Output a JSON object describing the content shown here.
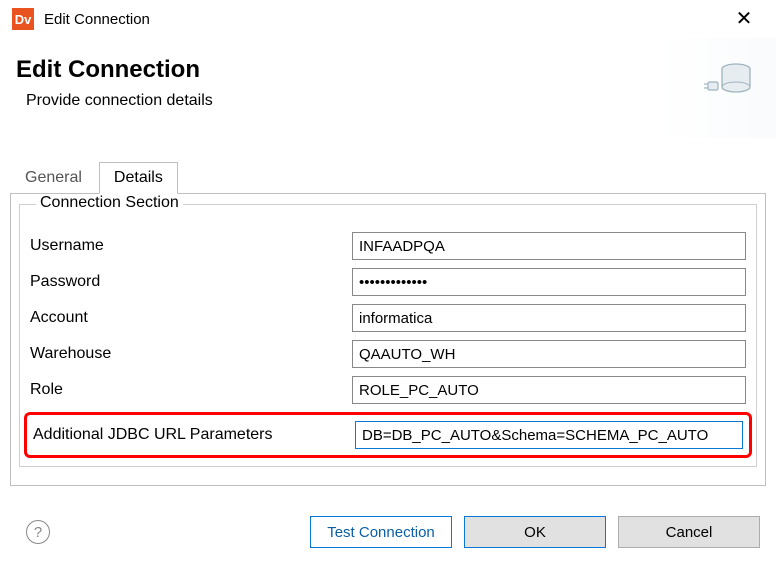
{
  "titlebar": {
    "app_icon_text": "Dv",
    "title": "Edit Connection"
  },
  "header": {
    "title": "Edit Connection",
    "subtitle": "Provide connection details"
  },
  "tabs": {
    "general": "General",
    "details": "Details",
    "active": "details"
  },
  "section": {
    "legend": "Connection Section",
    "fields": {
      "username": {
        "label": "Username",
        "value": "INFAADPQA"
      },
      "password": {
        "label": "Password",
        "value": "•••••••••••••"
      },
      "account": {
        "label": "Account",
        "value": "informatica"
      },
      "warehouse": {
        "label": "Warehouse",
        "value": "QAAUTO_WH"
      },
      "role": {
        "label": "Role",
        "value": "ROLE_PC_AUTO"
      },
      "jdbc": {
        "label": "Additional JDBC URL Parameters",
        "value": "DB=DB_PC_AUTO&Schema=SCHEMA_PC_AUTO"
      }
    }
  },
  "footer": {
    "test": "Test Connection",
    "ok": "OK",
    "cancel": "Cancel"
  }
}
